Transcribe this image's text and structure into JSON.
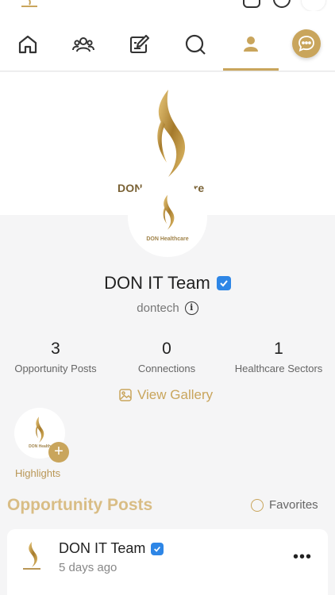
{
  "icons": {
    "home": "home-icon",
    "groups": "groups-icon",
    "compose": "compose-icon",
    "search": "search-icon",
    "profile": "profile-icon",
    "chat": "chat-icon",
    "verified": "verified-badge-icon",
    "info": "info-icon",
    "gallery": "image-icon",
    "add": "plus-icon",
    "more": "more-horizontal-icon"
  },
  "colors": {
    "accent": "#c9a55c",
    "verified": "#2e86e6",
    "section_title": "#d9bd85"
  },
  "cover": {
    "brand_text": "DON Healthcare"
  },
  "avatar": {
    "brand_text": "DON Healthcare"
  },
  "profile": {
    "name": "DON IT Team",
    "handle": "dontech"
  },
  "stats": [
    {
      "value": "3",
      "label": "Opportunity Posts"
    },
    {
      "value": "0",
      "label": "Connections"
    },
    {
      "value": "1",
      "label": "Healthcare Sectors"
    }
  ],
  "gallery": {
    "label": "View Gallery"
  },
  "highlights": {
    "label": "Highlights",
    "add_symbol": "+",
    "brand_text": "DON Health"
  },
  "posts_section": {
    "title": "Opportunity Posts",
    "favorites_label": "Favorites"
  },
  "post": {
    "author": "DON IT Team",
    "time": "5 days ago",
    "more": "•••"
  }
}
